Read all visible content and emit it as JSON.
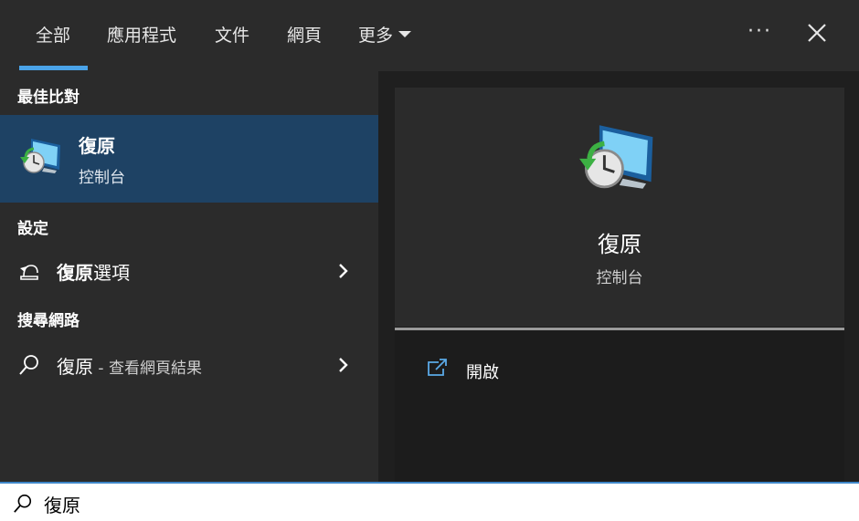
{
  "tabs": [
    {
      "label": "全部",
      "active": true
    },
    {
      "label": "應用程式"
    },
    {
      "label": "文件"
    },
    {
      "label": "網頁"
    },
    {
      "label": "更多"
    }
  ],
  "sections": {
    "best_match": "最佳比對",
    "settings": "設定",
    "web": "搜尋網路"
  },
  "best_match": {
    "title": "復原",
    "subtitle": "控制台",
    "icon": "recovery-icon"
  },
  "settings_item": {
    "bold": "復原",
    "rest": "選項",
    "icon": "recovery-options-icon"
  },
  "web_item": {
    "query": "復原",
    "suffix": " - 查看網頁結果",
    "icon": "search-icon"
  },
  "preview": {
    "title": "復原",
    "subtitle": "控制台",
    "action_open": "開啟"
  },
  "search": {
    "value": "復原"
  },
  "colors": {
    "accent": "#4aa3e8",
    "selected_bg": "#1e4264",
    "panel_bg": "#2b2b2b",
    "link_icon": "#5aa9e6"
  }
}
